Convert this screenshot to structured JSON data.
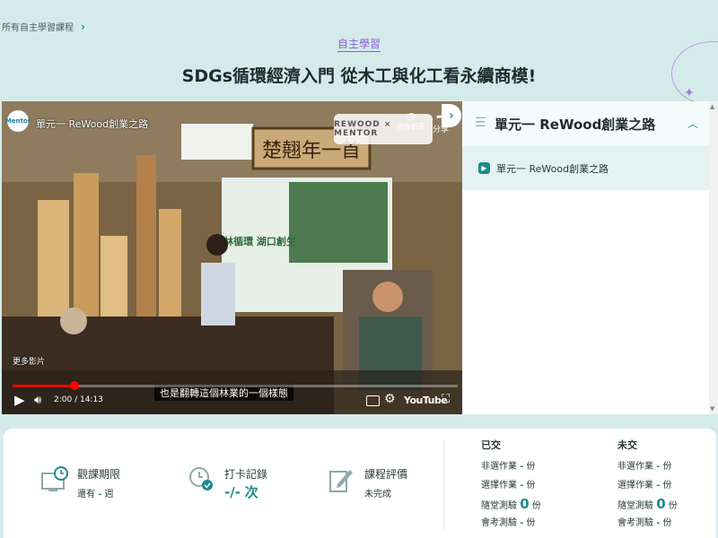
{
  "breadcrumb": {
    "label": "所有自主學習課程"
  },
  "category_tag": "自主學習",
  "page_title": "SDGs循環經濟入門 從木工與化工看永續商模!",
  "video": {
    "channel_logo_text": "Mentor",
    "title": "單元一 ReWood創業之路",
    "brand_badge": "REWOOD × MENTOR",
    "watch_later": "稍後觀看",
    "share": "分享",
    "more_videos": "更多影片",
    "subtitle": "也是翻轉這個林業的一個樣態",
    "time": "2:00 / 14:13",
    "progress_fraction": 0.14,
    "youtube_label": "YouTube",
    "sign_text": "楚翹年一首",
    "slide_title": "森林循環 湖口創生"
  },
  "side_panel": {
    "unit_title": "單元一 ReWood創業之路",
    "lessons": [
      {
        "label": "單元一 ReWood創業之路"
      }
    ]
  },
  "stats": {
    "viewing_period": {
      "label": "觀課期限",
      "prefix": "還有",
      "value": "-",
      "suffix": "週"
    },
    "checkin": {
      "label": "打卡記錄",
      "value": "-/-",
      "suffix": "次"
    },
    "rating": {
      "label": "課程評價",
      "value": "未完成"
    }
  },
  "homework": {
    "submitted": {
      "header": "已交",
      "rows": [
        {
          "label": "非選作業",
          "value": "-",
          "unit": "份"
        },
        {
          "label": "選擇作業",
          "value": "-",
          "unit": "份"
        },
        {
          "label": "隨堂測驗",
          "value": "0",
          "unit": "份"
        },
        {
          "label": "會考測驗",
          "value": "-",
          "unit": "份"
        }
      ]
    },
    "unsubmitted": {
      "header": "未交",
      "rows": [
        {
          "label": "非選作業",
          "value": "-",
          "unit": "份"
        },
        {
          "label": "選擇作業",
          "value": "-",
          "unit": "份"
        },
        {
          "label": "隨堂測驗",
          "value": "0",
          "unit": "份"
        },
        {
          "label": "會考測驗",
          "value": "-",
          "unit": "份"
        }
      ]
    }
  },
  "colors": {
    "accent": "#1b8c89",
    "purple": "#8a5fd0",
    "background": "#d5ebea"
  }
}
